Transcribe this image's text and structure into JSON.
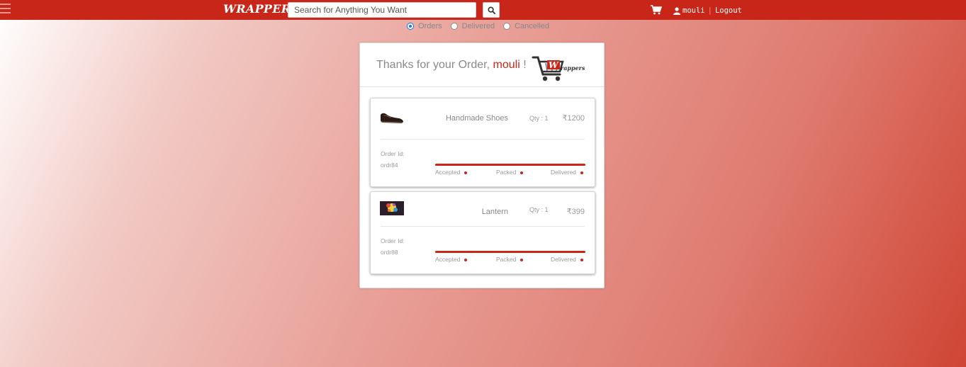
{
  "nav": {
    "brand": "WRAPPERS",
    "search_placeholder": "Search for Anything You Want",
    "username": "mouli",
    "logout": "Logout",
    "colors": {
      "bar": "#c9261a"
    }
  },
  "filters": [
    {
      "label": "Orders",
      "checked": true
    },
    {
      "label": "Delivered",
      "checked": false
    },
    {
      "label": "Cancelled",
      "checked": false
    }
  ],
  "panel": {
    "thanks_prefix": "Thanks for your Order,",
    "username": "mouli",
    "thanks_suffix": "!",
    "logo_text": "Wrappers"
  },
  "orders": [
    {
      "product": "Handmade Shoes",
      "qty": "Qty : 1",
      "price": "₹1200",
      "order_id_label": "Order Id:",
      "order_id": "ordr84",
      "steps": [
        "Accepted",
        "Packed",
        "Delivered"
      ],
      "thumb_icon": "shoe-image"
    },
    {
      "product": "Lantern",
      "qty": "Qty : 1",
      "price": "₹399",
      "order_id_label": "Order Id:",
      "order_id": "ordr88",
      "steps": [
        "Accepted",
        "Packed",
        "Delivered"
      ],
      "thumb_icon": "lantern-image"
    }
  ]
}
